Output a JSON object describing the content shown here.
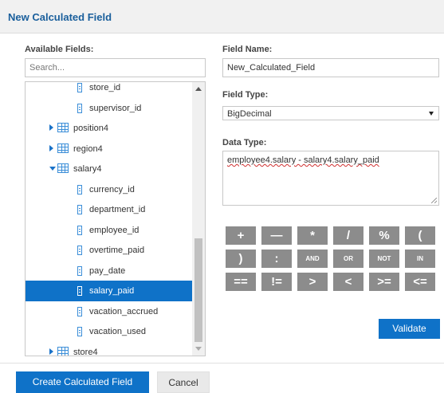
{
  "dialog": {
    "title": "New Calculated Field"
  },
  "left": {
    "available_fields_label": "Available Fields:",
    "search_placeholder": "Search...",
    "tree": [
      {
        "type": "field",
        "label": "store_id",
        "indent": 2
      },
      {
        "type": "field",
        "label": "supervisor_id",
        "indent": 2
      },
      {
        "type": "table",
        "label": "position4",
        "expanded": false
      },
      {
        "type": "table",
        "label": "region4",
        "expanded": false
      },
      {
        "type": "table",
        "label": "salary4",
        "expanded": true
      },
      {
        "type": "field",
        "label": "currency_id",
        "indent": 2
      },
      {
        "type": "field",
        "label": "department_id",
        "indent": 2
      },
      {
        "type": "field",
        "label": "employee_id",
        "indent": 2
      },
      {
        "type": "field",
        "label": "overtime_paid",
        "indent": 2
      },
      {
        "type": "field",
        "label": "pay_date",
        "indent": 2
      },
      {
        "type": "field",
        "label": "salary_paid",
        "indent": 2,
        "selected": true
      },
      {
        "type": "field",
        "label": "vacation_accrued",
        "indent": 2
      },
      {
        "type": "field",
        "label": "vacation_used",
        "indent": 2
      },
      {
        "type": "table",
        "label": "store4",
        "expanded": false
      }
    ]
  },
  "right": {
    "field_name_label": "Field Name:",
    "field_name_value": "New_Calculated_Field",
    "field_type_label": "Field Type:",
    "field_type_value": "BigDecimal",
    "data_type_label": "Data Type:",
    "expression": "employee4.salary - salary4.salary_paid",
    "operators": [
      "+",
      "—",
      "*",
      "/",
      "%",
      "(",
      ")",
      ":",
      "AND",
      "OR",
      "NOT",
      "IN",
      "==",
      "!=",
      ">",
      "<",
      ">=",
      "<="
    ],
    "validate_label": "Validate"
  },
  "footer": {
    "create_label": "Create Calculated Field",
    "cancel_label": "Cancel"
  },
  "colors": {
    "accent": "#0f72c8",
    "title": "#1a5f9c",
    "operator_bg": "#8c8c8c"
  }
}
